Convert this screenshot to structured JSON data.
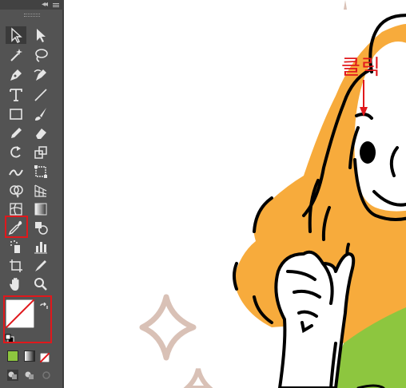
{
  "annotation": {
    "click_label": "클릭",
    "color": "#e0181c"
  },
  "toolbar": {
    "tools": [
      {
        "name": "selection-tool-icon",
        "selected": true
      },
      {
        "name": "direct-selection-tool-icon"
      },
      {
        "name": "magic-wand-tool-icon"
      },
      {
        "name": "lasso-tool-icon"
      },
      {
        "name": "pen-tool-icon"
      },
      {
        "name": "curvature-tool-icon"
      },
      {
        "name": "type-tool-icon"
      },
      {
        "name": "line-segment-tool-icon"
      },
      {
        "name": "rectangle-tool-icon"
      },
      {
        "name": "paintbrush-tool-icon"
      },
      {
        "name": "pencil-tool-icon"
      },
      {
        "name": "eraser-tool-icon"
      },
      {
        "name": "rotate-tool-icon"
      },
      {
        "name": "scale-tool-icon"
      },
      {
        "name": "width-tool-icon"
      },
      {
        "name": "free-transform-tool-icon"
      },
      {
        "name": "shape-builder-tool-icon"
      },
      {
        "name": "perspective-grid-tool-icon"
      },
      {
        "name": "mesh-tool-icon"
      },
      {
        "name": "gradient-tool-icon"
      },
      {
        "name": "eyedropper-tool-icon",
        "highlighted": true
      },
      {
        "name": "blend-tool-icon"
      },
      {
        "name": "symbol-sprayer-tool-icon"
      },
      {
        "name": "column-graph-tool-icon"
      },
      {
        "name": "artboard-tool-icon"
      },
      {
        "name": "slice-tool-icon"
      },
      {
        "name": "hand-tool-icon"
      },
      {
        "name": "zoom-tool-icon"
      }
    ],
    "fill": "none",
    "stroke": "#000000",
    "color_modes": [
      "color-mode-icon",
      "gradient-mode-icon",
      "none-mode-icon"
    ],
    "draw_modes": [
      "draw-normal-icon",
      "draw-behind-icon",
      "draw-inside-icon"
    ]
  },
  "colors": {
    "hair": "#f7ab3c",
    "shirt": "#8dc63f",
    "sparkle": "#d9c1b6",
    "line": "#000000"
  }
}
